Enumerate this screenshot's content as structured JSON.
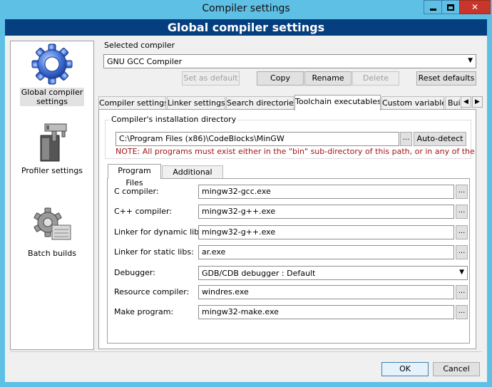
{
  "window": {
    "title": "Compiler settings",
    "close_glyph": "✕"
  },
  "banner": "Global compiler settings",
  "sidebar": {
    "items": [
      {
        "label_line1": "Global compiler",
        "label_line2": "settings",
        "icon": "gear-icon"
      },
      {
        "label": "Profiler settings",
        "icon": "caliper-icon"
      },
      {
        "label": "Batch builds",
        "icon": "batch-gear-icon"
      }
    ]
  },
  "selected_compiler": {
    "label": "Selected compiler",
    "value": "GNU GCC Compiler"
  },
  "compiler_buttons": {
    "set_default": "Set as default",
    "copy": "Copy",
    "rename": "Rename",
    "delete": "Delete",
    "reset_defaults": "Reset defaults"
  },
  "tabs": [
    {
      "label": "Compiler settings"
    },
    {
      "label": "Linker settings"
    },
    {
      "label": "Search directories"
    },
    {
      "label": "Toolchain executables"
    },
    {
      "label": "Custom variables"
    },
    {
      "label": "Bui"
    }
  ],
  "tab_scroll": {
    "left": "◀",
    "right": "▶"
  },
  "install_dir": {
    "group_title": "Compiler's installation directory",
    "value": "C:\\Program Files (x86)\\CodeBlocks\\MinGW",
    "browse": "...",
    "autodetect": "Auto-detect",
    "note": "NOTE: All programs must exist either in the \"bin\" sub-directory of this path, or in any of the"
  },
  "subtabs": [
    {
      "label": "Program Files"
    },
    {
      "label": "Additional Paths"
    }
  ],
  "programs": {
    "c_compiler": {
      "label": "C compiler:",
      "value": "mingw32-gcc.exe"
    },
    "cpp_compiler": {
      "label": "C++ compiler:",
      "value": "mingw32-g++.exe"
    },
    "linker_dynamic": {
      "label": "Linker for dynamic libs:",
      "value": "mingw32-g++.exe"
    },
    "linker_static": {
      "label": "Linker for static libs:",
      "value": "ar.exe"
    },
    "debugger": {
      "label": "Debugger:",
      "value": "GDB/CDB debugger : Default"
    },
    "resource_compiler": {
      "label": "Resource compiler:",
      "value": "windres.exe"
    },
    "make_program": {
      "label": "Make program:",
      "value": "mingw32-make.exe"
    },
    "browse": "..."
  },
  "dialog_buttons": {
    "ok": "OK",
    "cancel": "Cancel"
  },
  "dropdown_arrow": "▼"
}
